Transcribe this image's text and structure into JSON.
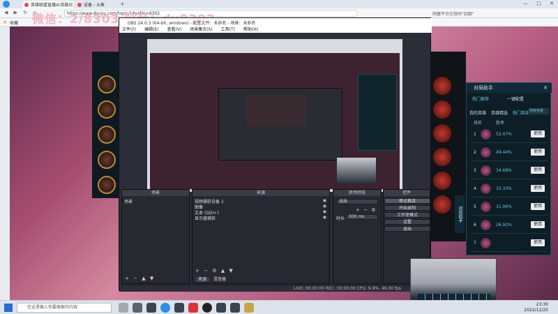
{
  "browser": {
    "tabs": [
      {
        "label": "英雄联盟直播dr英雄对"
      },
      {
        "label": "设备 - 斗鱼"
      }
    ],
    "url": "https://www.douyu.com/topic/10yxf/ri=6302",
    "window_controls": [
      "—",
      "□",
      "✕"
    ],
    "right_hint": "网塞平台在限时\"四额\"",
    "bookmarks_label": "收藏"
  },
  "overlay": {
    "line": "微信：2/8303 抖音：dy8302"
  },
  "obs": {
    "title": "OBS 24.0.3 (64-bit, windows) - 配置文件：未命名 - 场景：未命名",
    "menu": [
      "文件(F)",
      "编辑(E)",
      "查看(V)",
      "场景集合(S)",
      "工具(T)",
      "帮助(H)"
    ],
    "docks": {
      "scenes": {
        "title": "场景",
        "items": [
          "场景"
        ]
      },
      "sources": {
        "title": "来源",
        "items": [
          "视频捕获设备 2",
          "图像",
          "文本 (GDI+)",
          "显示器捕获"
        ]
      },
      "mixer": {
        "title": "转场特效",
        "items": [
          "淡出"
        ],
        "duration_label": "时长",
        "duration_value": "300 ms"
      },
      "controls": {
        "title": "控件",
        "buttons": [
          "停止推流",
          "开始录制",
          "工作室模式",
          "设置",
          "退出"
        ]
      }
    },
    "tab_labels": [
      "来源",
      "混音器"
    ],
    "status": "LIVE: 00:00:00   REC: 00:00:00   CPU: 9.9%, 46.00 fps"
  },
  "helper": {
    "title": "对局助手",
    "tabs": [
      "热门推荐",
      "一键配置"
    ],
    "subtabs": [
      "我的英雄",
      "英雄精选",
      "热门英雄"
    ],
    "search_placeholder": "搜索英雄",
    "col_headers": [
      "排名",
      "胜率"
    ],
    "rows": [
      {
        "rank": "1",
        "pct": "52.47%",
        "btn": "使用"
      },
      {
        "rank": "2",
        "pct": "49.44%",
        "btn": "使用"
      },
      {
        "rank": "3",
        "pct": "34.68%",
        "btn": "使用"
      },
      {
        "rank": "4",
        "pct": "33.33%",
        "btn": "使用"
      },
      {
        "rank": "5",
        "pct": "31.96%",
        "btn": "使用"
      },
      {
        "rank": "6",
        "pct": "26.92%",
        "btn": "使用"
      },
      {
        "rank": "7",
        "pct": "",
        "btn": "使用"
      }
    ],
    "side_label": "对局助手"
  },
  "taskbar": {
    "search_placeholder": "在这里输入你要搜索的内容",
    "time": "23:30",
    "date": "2022/12/25"
  },
  "colors": {
    "accent_gold": "#e2a526",
    "obs_bg": "#2b2e38",
    "helper_accent": "#68c7e5"
  }
}
